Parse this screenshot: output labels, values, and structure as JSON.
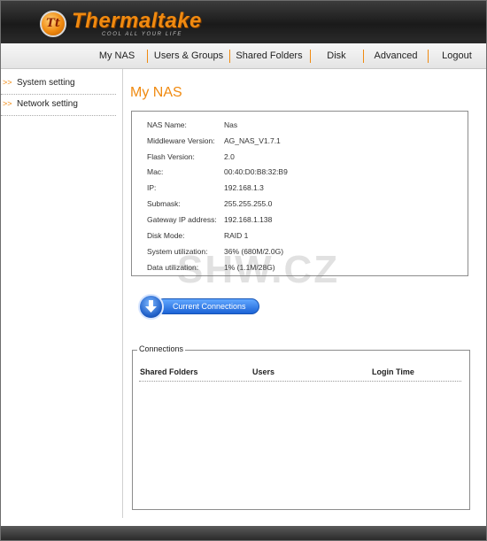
{
  "brand": {
    "logo_initials": "Tt",
    "name": "Thermaltake",
    "tagline": "COOL ALL YOUR LIFE",
    "accent_color": "#f08a10"
  },
  "nav": {
    "items": [
      "My NAS",
      "Users & Groups",
      "Shared Folders",
      "Disk",
      "Advanced",
      "Logout"
    ]
  },
  "sidebar": {
    "items": [
      {
        "arrow": ">>",
        "label": "System setting"
      },
      {
        "arrow": ">>",
        "label": "Network setting"
      }
    ]
  },
  "main": {
    "title": "My NAS",
    "info": [
      {
        "label": "NAS Name:",
        "value": "Nas"
      },
      {
        "label": "Middleware Version:",
        "value": "AG_NAS_V1.7.1"
      },
      {
        "label": "Flash Version:",
        "value": "2.0"
      },
      {
        "label": "Mac:",
        "value": "00:40:D0:B8:32:B9"
      },
      {
        "label": "IP:",
        "value": "192.168.1.3"
      },
      {
        "label": "Submask:",
        "value": "255.255.255.0"
      },
      {
        "label": "Gateway IP address:",
        "value": "192.168.1.138"
      },
      {
        "label": "Disk Mode:",
        "value": "RAID 1"
      },
      {
        "label": "System utilization:",
        "value": "36% (680M/2.0G)"
      },
      {
        "label": "Data utilization:",
        "value": "1% (1.1M/28G)"
      }
    ],
    "watermark": "SHW.CZ",
    "current_connections_button": "Current Connections",
    "button_icon": "download-arrow-icon",
    "connections": {
      "legend": "Connections",
      "columns": [
        "Shared Folders",
        "Users",
        "Login Time"
      ],
      "rows": []
    }
  }
}
